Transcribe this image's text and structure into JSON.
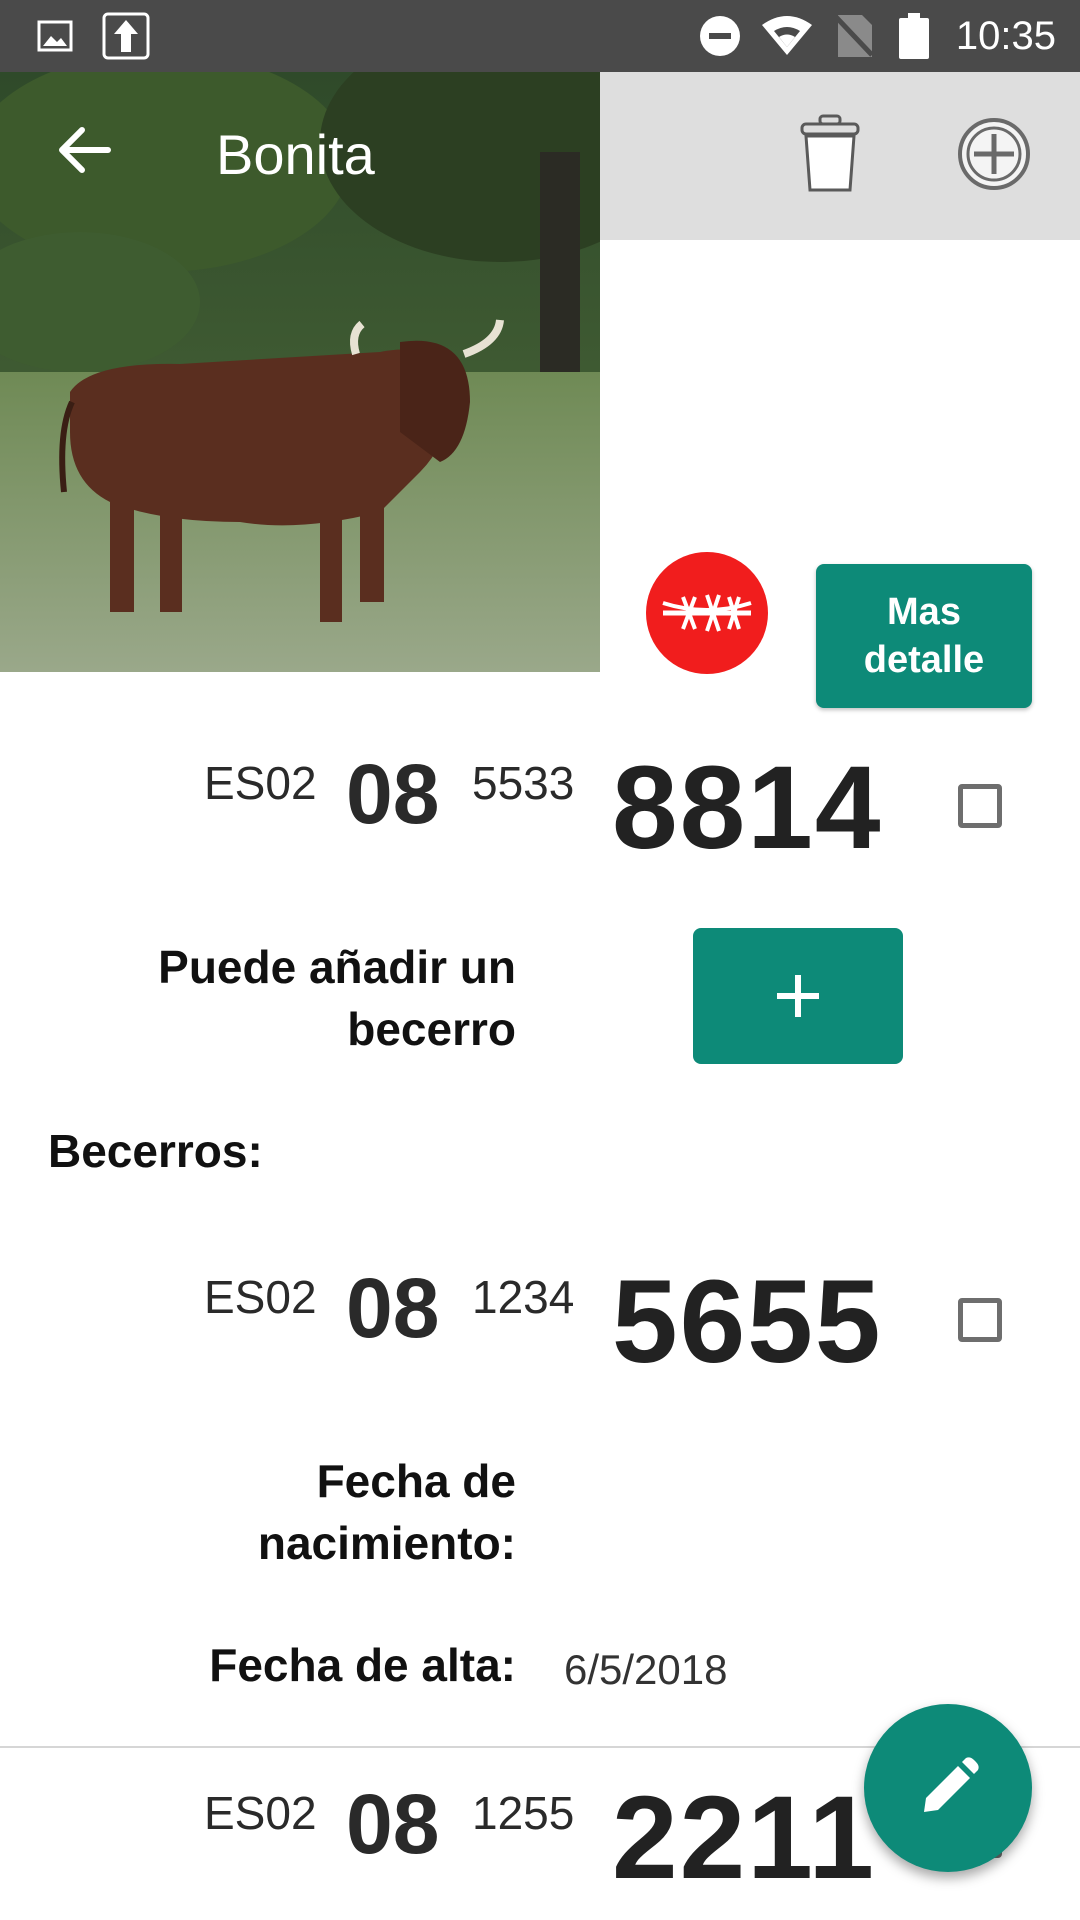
{
  "status_bar": {
    "time": "10:35",
    "icons": [
      "gallery-icon",
      "upload-icon",
      "do-not-disturb-icon",
      "wifi-icon",
      "no-sim-icon",
      "battery-icon"
    ]
  },
  "toolbar": {
    "title": "Bonita",
    "back_icon": "arrow-left-icon",
    "delete_icon": "trash-icon",
    "add_icon": "add-circle-icon"
  },
  "animal": {
    "photo": "bull-photo",
    "status_icon": "barbed-wire-icon",
    "status_color": "#f11d1d",
    "detail_button": "Mas\ndetalle",
    "tag": {
      "prefix": "ES02",
      "mid": "08",
      "small": "5533",
      "big": "8814"
    }
  },
  "add_calf": {
    "text": "Puede añadir un\nbecerro",
    "button_icon": "plus-icon"
  },
  "calves_header": "Becerros:",
  "calves": [
    {
      "tag": {
        "prefix": "ES02",
        "mid": "08",
        "small": "1234",
        "big": "5655"
      },
      "birth_label": "Fecha de\nnacimiento:",
      "birth_value": "",
      "registration_label": "Fecha de alta:",
      "registration_value": "6/5/2018"
    },
    {
      "tag": {
        "prefix": "ES02",
        "mid": "08",
        "small": "1255",
        "big": "2211"
      }
    }
  ],
  "fab_icon": "edit-pencil-icon",
  "colors": {
    "accent": "#0d8a78",
    "status_bar": "#4a4a4a",
    "toolbar_bg": "#dedede",
    "alert_red": "#f11d1d"
  }
}
